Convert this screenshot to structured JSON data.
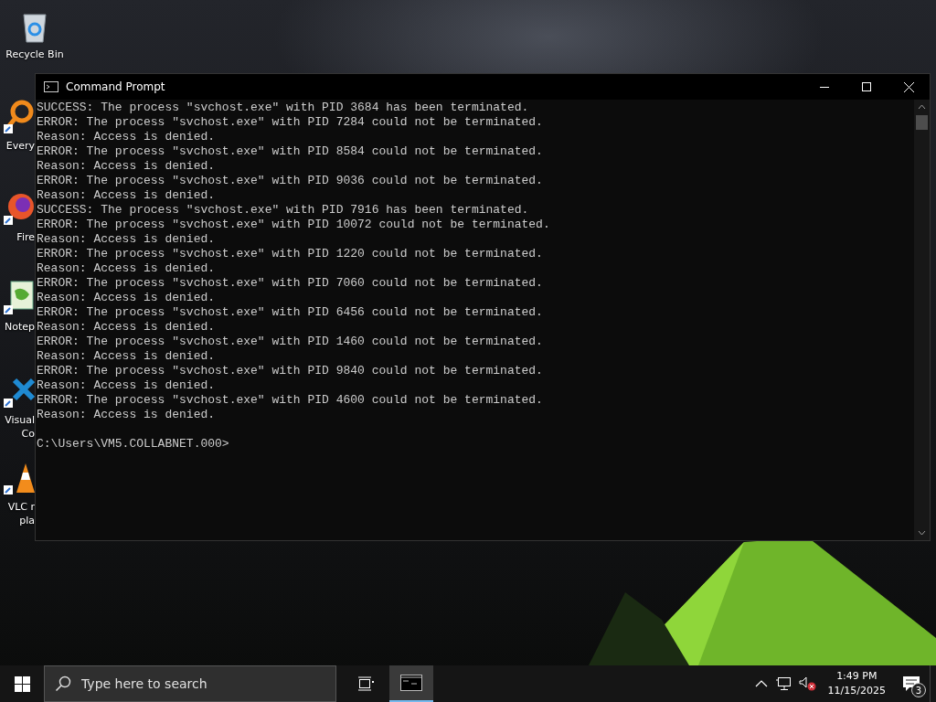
{
  "desktop_icons": [
    {
      "kind": "recycle",
      "label_lines": [
        "Recycle Bin"
      ]
    },
    {
      "kind": "search",
      "label_lines": [
        "Every"
      ]
    },
    {
      "kind": "browser",
      "label_lines": [
        "Fire"
      ]
    },
    {
      "kind": "notepad",
      "label_lines": [
        "Notep"
      ]
    },
    {
      "kind": "code",
      "label_lines": [
        "Visual",
        "Co"
      ]
    },
    {
      "kind": "cone",
      "label_lines": [
        "VLC r",
        "pla"
      ]
    }
  ],
  "window": {
    "title": "Command Prompt",
    "output_lines": [
      "SUCCESS: The process \"svchost.exe\" with PID 3684 has been terminated.",
      "ERROR: The process \"svchost.exe\" with PID 7284 could not be terminated.",
      "Reason: Access is denied.",
      "ERROR: The process \"svchost.exe\" with PID 8584 could not be terminated.",
      "Reason: Access is denied.",
      "ERROR: The process \"svchost.exe\" with PID 9036 could not be terminated.",
      "Reason: Access is denied.",
      "SUCCESS: The process \"svchost.exe\" with PID 7916 has been terminated.",
      "ERROR: The process \"svchost.exe\" with PID 10072 could not be terminated.",
      "Reason: Access is denied.",
      "ERROR: The process \"svchost.exe\" with PID 1220 could not be terminated.",
      "Reason: Access is denied.",
      "ERROR: The process \"svchost.exe\" with PID 7060 could not be terminated.",
      "Reason: Access is denied.",
      "ERROR: The process \"svchost.exe\" with PID 6456 could not be terminated.",
      "Reason: Access is denied.",
      "ERROR: The process \"svchost.exe\" with PID 1460 could not be terminated.",
      "Reason: Access is denied.",
      "ERROR: The process \"svchost.exe\" with PID 9840 could not be terminated.",
      "Reason: Access is denied.",
      "ERROR: The process \"svchost.exe\" with PID 4600 could not be terminated.",
      "Reason: Access is denied."
    ],
    "prompt": "C:\\Users\\VM5.COLLABNET.000>"
  },
  "taskbar": {
    "search": {
      "placeholder": "Type here to search"
    },
    "clock": {
      "time": "1:49 PM",
      "date": "11/15/2025"
    },
    "notification_count": "3"
  }
}
